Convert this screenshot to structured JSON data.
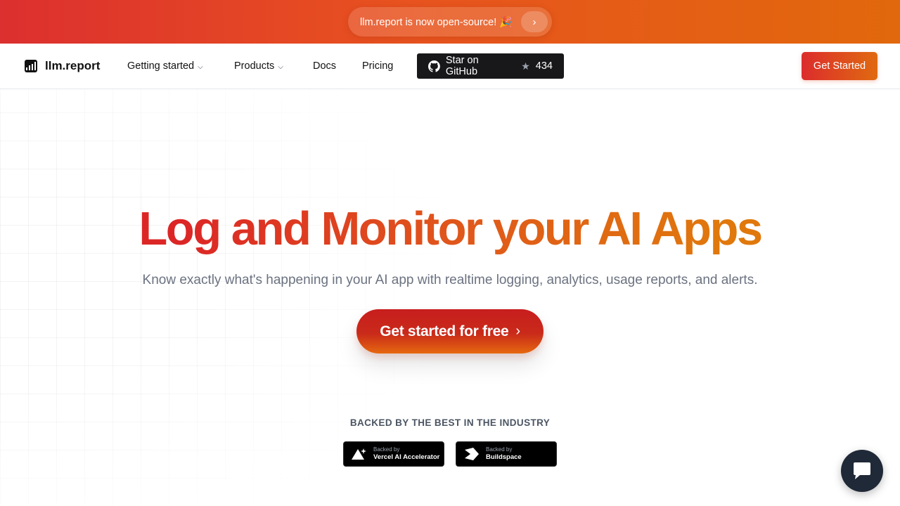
{
  "banner": {
    "text": "llm.report is now open-source! 🎉",
    "arrow": "›"
  },
  "nav": {
    "logo": "llm.report",
    "links": [
      {
        "label": "Getting started",
        "dropdown": true
      },
      {
        "label": "Products",
        "dropdown": true
      },
      {
        "label": "Docs",
        "dropdown": false
      },
      {
        "label": "Pricing",
        "dropdown": false
      }
    ],
    "github": {
      "label": "Star on GitHub",
      "stars": "434"
    },
    "cta": "Get Started"
  },
  "hero": {
    "title": "Log and Monitor your AI Apps",
    "subtitle": "Know exactly what's happening in your AI app with realtime logging, analytics, usage reports, and alerts.",
    "cta": "Get started for free"
  },
  "backed": {
    "label": "BACKED BY THE BEST IN THE INDUSTRY",
    "badges": [
      {
        "small": "Backed by",
        "name": "Vercel AI Accelerator"
      },
      {
        "small": "Backed by",
        "name": "Buildspace"
      }
    ]
  },
  "colors": {
    "accent_red": "#dc2626",
    "accent_orange": "#e0780c",
    "dark": "#18181b"
  }
}
